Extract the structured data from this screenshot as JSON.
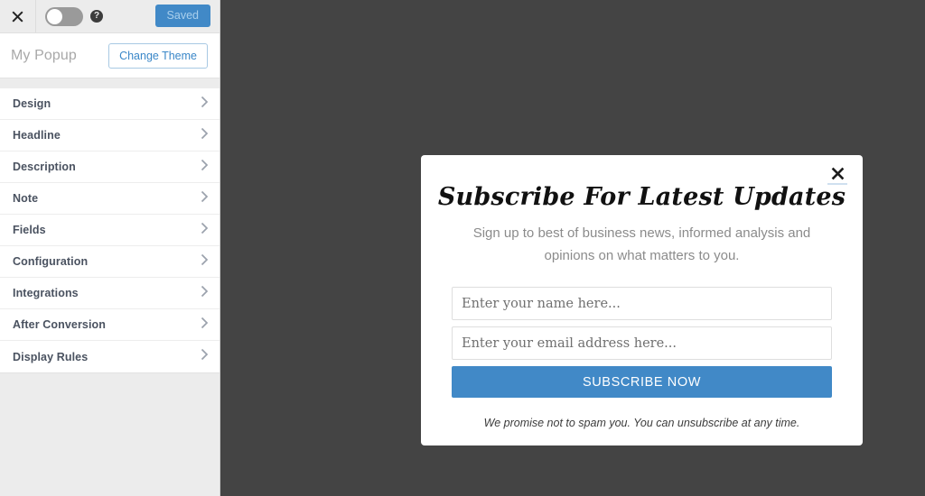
{
  "toolbar": {
    "close_icon": "close-icon",
    "toggle": {
      "name": "enable-toggle",
      "state": "off"
    },
    "help_icon": "help-icon",
    "help_glyph": "?",
    "saved_label": "Saved"
  },
  "header": {
    "title": "My Popup",
    "change_theme_label": "Change Theme"
  },
  "sidebar": {
    "items": [
      {
        "label": "Design",
        "icon": "chevron-right-icon"
      },
      {
        "label": "Headline",
        "icon": "chevron-right-icon"
      },
      {
        "label": "Description",
        "icon": "chevron-right-icon"
      },
      {
        "label": "Note",
        "icon": "chevron-right-icon"
      },
      {
        "label": "Fields",
        "icon": "chevron-right-icon"
      },
      {
        "label": "Configuration",
        "icon": "chevron-right-icon"
      },
      {
        "label": "Integrations",
        "icon": "chevron-right-icon"
      },
      {
        "label": "After Conversion",
        "icon": "chevron-right-icon"
      },
      {
        "label": "Display Rules",
        "icon": "chevron-right-icon"
      }
    ]
  },
  "popup": {
    "close_icon": "close-icon",
    "heading": "Subscribe For Latest Updates",
    "description": "Sign up to best of business news, informed analysis and opinions on what matters to you.",
    "name_placeholder": "Enter your name here...",
    "name_value": "",
    "email_placeholder": "Enter your email address here...",
    "email_value": "",
    "submit_label": "SUBSCRIBE NOW",
    "footnote": "We promise not to spam you. You can unsubscribe at any time."
  },
  "colors": {
    "accent_blue": "#4189c7",
    "canvas_background": "#444444",
    "sidebar_background": "#ececec",
    "panel_white": "#ffffff",
    "menu_text": "#4a5260"
  }
}
